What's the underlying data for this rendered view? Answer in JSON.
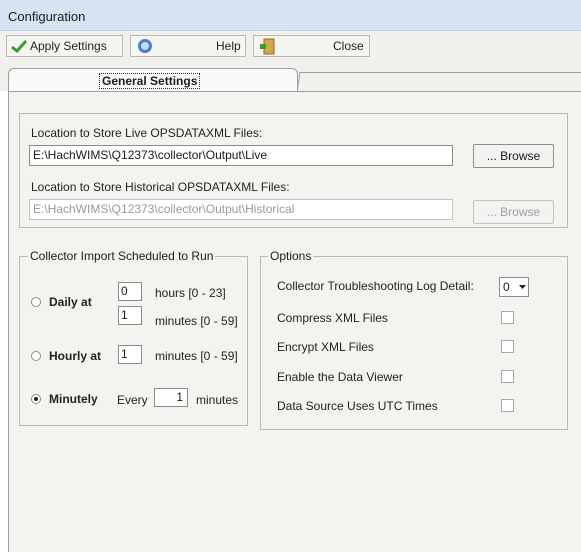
{
  "window": {
    "title": "Configuration"
  },
  "toolbar": {
    "apply_label": "Apply Settings",
    "help_label": "Help",
    "close_label": "Close"
  },
  "tabs": {
    "active": "General Settings"
  },
  "locations": {
    "live_label": "Location to Store Live OPSDATAXML Files:",
    "live_value": "E:\\HachWIMS\\Q12373\\collector\\Output\\Live",
    "browse_label": "... Browse",
    "historical_label": "Location to Store Historical OPSDATAXML Files:",
    "historical_value": "E:\\HachWIMS\\Q12373\\collector\\Output\\Historical"
  },
  "schedule": {
    "legend": "Collector Import Scheduled to Run",
    "daily_label": "Daily at",
    "daily_hours": "0",
    "hours_hint": "hours [0 - 23]",
    "daily_minutes": "1",
    "minutes_hint": "minutes [0 - 59]",
    "hourly_label": "Hourly at",
    "hourly_minutes": "1",
    "minutely_label": "Minutely",
    "every_label": "Every",
    "every_value": "1",
    "every_unit": "minutes",
    "selected": "minutely"
  },
  "options": {
    "legend": "Options",
    "log_label": "Collector Troubleshooting Log Detail:",
    "log_value": "0",
    "compress_label": "Compress XML Files",
    "encrypt_label": "Encrypt XML Files",
    "viewer_label": "Enable the Data Viewer",
    "utc_label": "Data Source Uses UTC Times"
  },
  "colors": {
    "checkmark": "#3a9a2e",
    "help_icon": "#4a7fd0",
    "close_icon": "#b58a2b"
  }
}
